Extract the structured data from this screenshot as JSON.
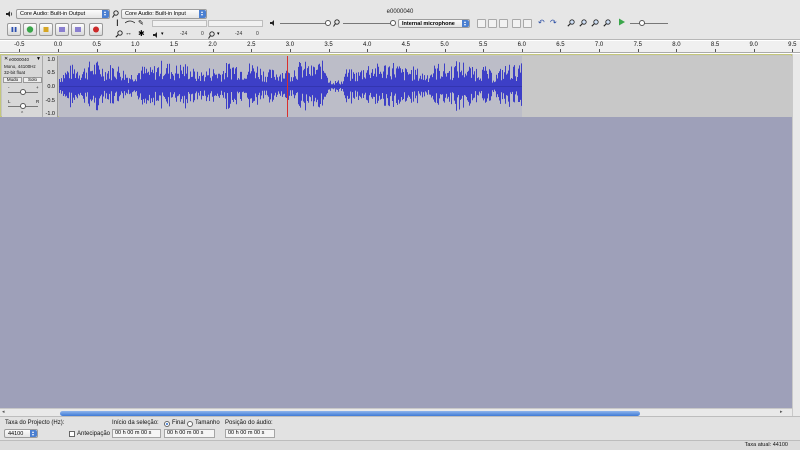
{
  "window": {
    "title": "e0000040"
  },
  "devices": {
    "output": "Core Audio: Built-in Output",
    "input": "Core Audio: Built-in Input",
    "recording_source": "Internal microphone"
  },
  "meters": {
    "playback_scale": [
      "-24",
      "0"
    ],
    "record_scale": [
      "-24",
      "0"
    ]
  },
  "ruler": {
    "labels": [
      "-0.5",
      "0.0",
      "0.5",
      "1.0",
      "1.5",
      "2.0",
      "2.5",
      "3.0",
      "3.5",
      "4.0",
      "4.5",
      "5.0",
      "5.5",
      "6.0",
      "6.5",
      "7.0",
      "7.5",
      "8.0",
      "8.5",
      "9.0",
      "9.5"
    ]
  },
  "track": {
    "name": "e0000040",
    "info_line1": "Mono, 44100Hz",
    "info_line2": "32-bit float",
    "mute_label": "Mudo",
    "solo_label": "Solo",
    "gain_minus": "-",
    "gain_plus": "+",
    "pan_left": "L",
    "pan_right": "R",
    "scale": [
      "1.0",
      "0.5",
      "0.0",
      "-0.5",
      "-1.0"
    ],
    "waveform_color": "#3d3fc7",
    "duration_seconds": 6.0,
    "playhead_seconds": 2.95
  },
  "selection": {
    "project_rate_label": "Taxa do Projecto (Hz):",
    "project_rate_value": "44100",
    "snap_label": "Antecipação",
    "selection_start_label": "Início da seleção:",
    "end_label": "Final",
    "length_label": "Tamanho",
    "audio_position_label": "Posição do áudio:",
    "start_time": "00 h 00 m 00 s",
    "end_time": "00 h 00 m 00 s",
    "audio_position": "00 h 00 m 00 s"
  },
  "status": {
    "actual_rate": "Taxa atual: 44100"
  },
  "colors": {
    "track_area_bg": "#9ea0b9",
    "playhead": "#d9302c",
    "accent": "#3f7ad6"
  }
}
